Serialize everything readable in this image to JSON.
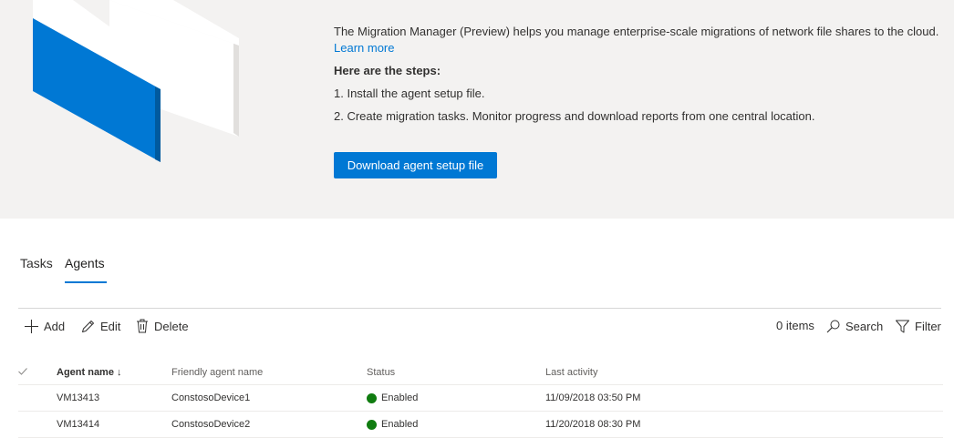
{
  "intro": {
    "description": "The Migration Manager (Preview) helps you manage enterprise-scale migrations of network file shares to the cloud.",
    "learn_more": "Learn more",
    "steps_title": "Here are the steps:",
    "step1": "1. Install the agent setup file.",
    "step2": "2. Create migration tasks. Monitor progress and download reports from one central location.",
    "download_label": "Download agent setup file"
  },
  "tabs": [
    {
      "label": "Tasks",
      "selected": false
    },
    {
      "label": "Agents",
      "selected": true
    }
  ],
  "toolbar": {
    "add_label": "Add",
    "edit_label": "Edit",
    "delete_label": "Delete",
    "items_count": "0 items",
    "search_label": "Search",
    "filter_label": "Filter"
  },
  "table": {
    "check_icon": "check-icon",
    "columns": {
      "agent_name": "Agent name",
      "friendly_name": "Friendly agent name",
      "status": "Status",
      "last_activity": "Last activity"
    },
    "sort_indicator": "↓",
    "rows": [
      {
        "agent_name": "VM13413",
        "friendly_name": "ConstosoDevice1",
        "status": "Enabled",
        "last_activity": "11/09/2018 03:50 PM"
      },
      {
        "agent_name": "VM13414",
        "friendly_name": "ConstosoDevice2",
        "status": "Enabled",
        "last_activity": "11/20/2018 08:30 PM"
      }
    ]
  },
  "colors": {
    "accent": "#0078d4",
    "status_enabled": "#107c10",
    "hero_background": "#f3f2f1"
  }
}
